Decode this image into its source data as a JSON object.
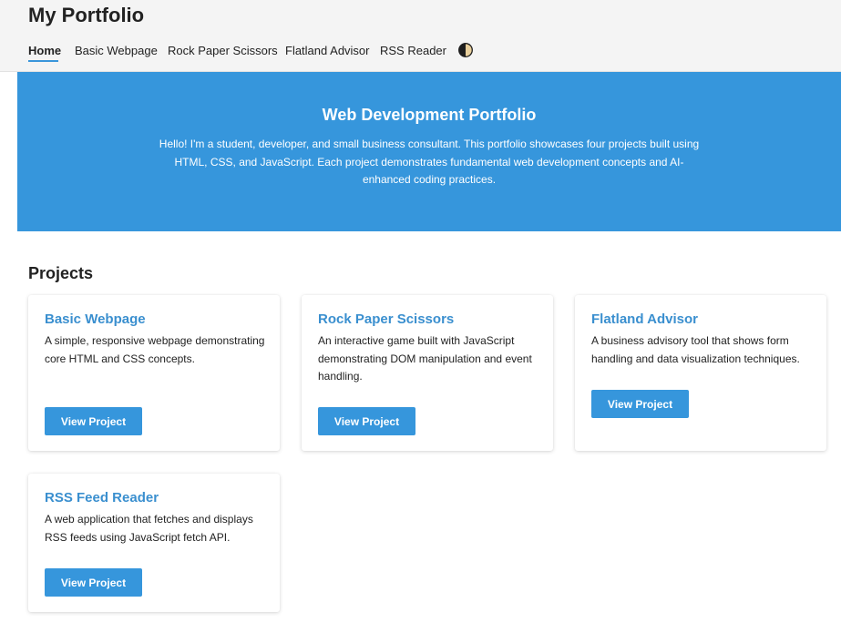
{
  "header": {
    "site_title": "My Portfolio",
    "nav": [
      {
        "label": "Home",
        "active": true
      },
      {
        "label": "Basic Webpage"
      },
      {
        "label": "Rock Paper Scissors"
      },
      {
        "label": "Flatland Advisor"
      },
      {
        "label": "RSS Reader"
      }
    ],
    "theme_toggle_icon": "contrast-icon"
  },
  "hero": {
    "title": "Web Development Portfolio",
    "text": "Hello! I'm a student, developer, and small business consultant. This portfolio showcases four projects built using HTML, CSS, and JavaScript. Each project demonstrates fundamental web development concepts and AI-enhanced coding practices."
  },
  "projects": {
    "heading": "Projects",
    "items": [
      {
        "title": "Basic Webpage",
        "description": "A simple, responsive webpage demonstrating core HTML and CSS concepts.",
        "button": "View Project"
      },
      {
        "title": "Rock Paper Scissors",
        "description": "An interactive game built with JavaScript demonstrating DOM manipulation and event handling.",
        "button": "View Project"
      },
      {
        "title": "Flatland Advisor",
        "description": "A business advisory tool that shows form handling and data visualization techniques.",
        "button": "View Project"
      },
      {
        "title": "RSS Feed Reader",
        "description": "A web application that fetches and displays RSS feeds using JavaScript fetch API.",
        "button": "View Project"
      }
    ]
  },
  "colors": {
    "accent": "#3696dc",
    "link": "#3a8fcf",
    "header_bg": "#f4f4f4"
  }
}
